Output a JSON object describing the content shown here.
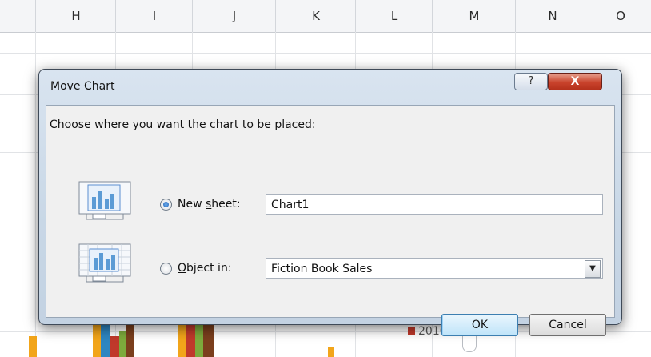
{
  "spreadsheet": {
    "columns": [
      "H",
      "I",
      "J",
      "K",
      "L",
      "M",
      "N",
      "O"
    ],
    "legend_label": "2010",
    "colors": {
      "bar_orange": "#f2a51a",
      "bar_blue": "#2e86c1",
      "bar_red": "#c0392b",
      "bar_green": "#7daa3c",
      "bar_brown": "#7b3f1d"
    }
  },
  "dialog": {
    "title": "Move Chart",
    "help_label": "?",
    "close_label": "X",
    "prompt": "Choose where you want the chart to be placed:",
    "new_sheet": {
      "label_prefix": "New ",
      "label_mnemonic": "s",
      "label_suffix": "heet:",
      "value": "Chart1",
      "selected": true,
      "icon": "new-sheet-chart-icon"
    },
    "object_in": {
      "label_mnemonic": "O",
      "label_suffix": "bject in:",
      "value": "Fiction Book Sales",
      "selected": false,
      "icon": "embedded-chart-icon"
    },
    "ok_label": "OK",
    "cancel_label": "Cancel"
  }
}
